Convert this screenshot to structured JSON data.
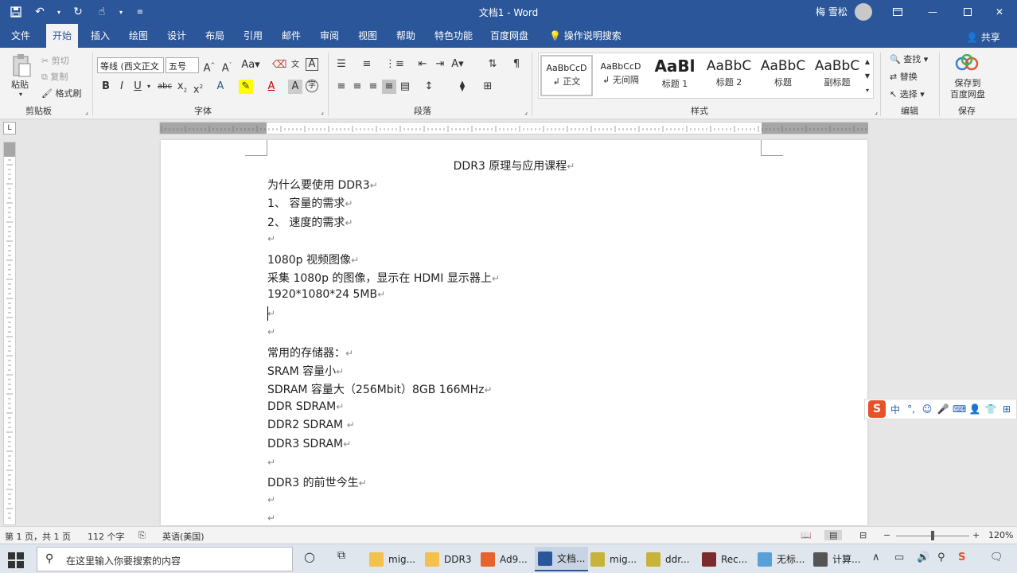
{
  "titlebar": {
    "title": "文档1 - Word",
    "user": "梅 雪松",
    "qa_save": "save",
    "qa_undo": "undo",
    "qa_redo": "redo",
    "qa_touch": "touch-mode",
    "qa_more": "more"
  },
  "menu": {
    "tabs": [
      "文件",
      "开始",
      "插入",
      "绘图",
      "设计",
      "布局",
      "引用",
      "邮件",
      "审阅",
      "视图",
      "帮助",
      "特色功能",
      "百度网盘"
    ],
    "tell_me": "操作说明搜索",
    "share": "共享"
  },
  "ribbon": {
    "clipboard": {
      "paste": "粘贴",
      "cut": "剪切",
      "copy": "复制",
      "format_painter": "格式刷",
      "label": "剪贴板"
    },
    "font": {
      "family": "等线 (西文正文",
      "size": "五号",
      "label": "字体"
    },
    "paragraph": {
      "label": "段落"
    },
    "styles": {
      "label": "样式",
      "items": [
        {
          "preview": "AaBbCcD",
          "name": "正文"
        },
        {
          "preview": "AaBbCcD",
          "name": "无间隔"
        },
        {
          "preview": "AaBl",
          "name": "标题 1"
        },
        {
          "preview": "AaBbC",
          "name": "标题 2"
        },
        {
          "preview": "AaBbC",
          "name": "标题"
        },
        {
          "preview": "AaBbC",
          "name": "副标题"
        }
      ]
    },
    "editing": {
      "find": "查找",
      "replace": "替换",
      "select": "选择",
      "label": "编辑"
    },
    "save": {
      "button": "保存到\n百度网盘",
      "label": "保存"
    }
  },
  "ruler": {
    "corner": "L"
  },
  "document": {
    "title": "DDR3 原理与应用课程",
    "lines": [
      "为什么要使用 DDR3",
      "1、 容量的需求",
      "2、 速度的需求",
      "",
      "1080p 视频图像",
      "采集 1080p 的图像，显示在 HDMI 显示器上",
      "1920*1080*24    5MB",
      "",
      "",
      "常用的存储器：",
      "SRAM 容量小",
      "SDRAM  容量大（256Mbit）8GB   166MHz",
      "DDR SDRAM",
      "DDR2 SDRAM  ",
      "DDR3 SDRAM",
      "",
      "DDR3 的前世今生",
      "",
      ""
    ]
  },
  "ime": {
    "lang": "中",
    "punct": "°,"
  },
  "status": {
    "page": "第 1 页，共 1 页",
    "words": "112 个字",
    "lang": "英语(美国)",
    "zoom": "120%"
  },
  "taskbar": {
    "search_placeholder": "在这里输入你要搜索的内容",
    "tasks": [
      "mig...",
      "DDR3",
      "Ad9...",
      "文档...",
      "mig...",
      "ddr...",
      "Rec...",
      "无标...",
      "计算..."
    ]
  },
  "colors": {
    "brand": "#2b579a",
    "ribbon_bg": "#f3f3f3",
    "ime_logo": "#e8512a"
  }
}
